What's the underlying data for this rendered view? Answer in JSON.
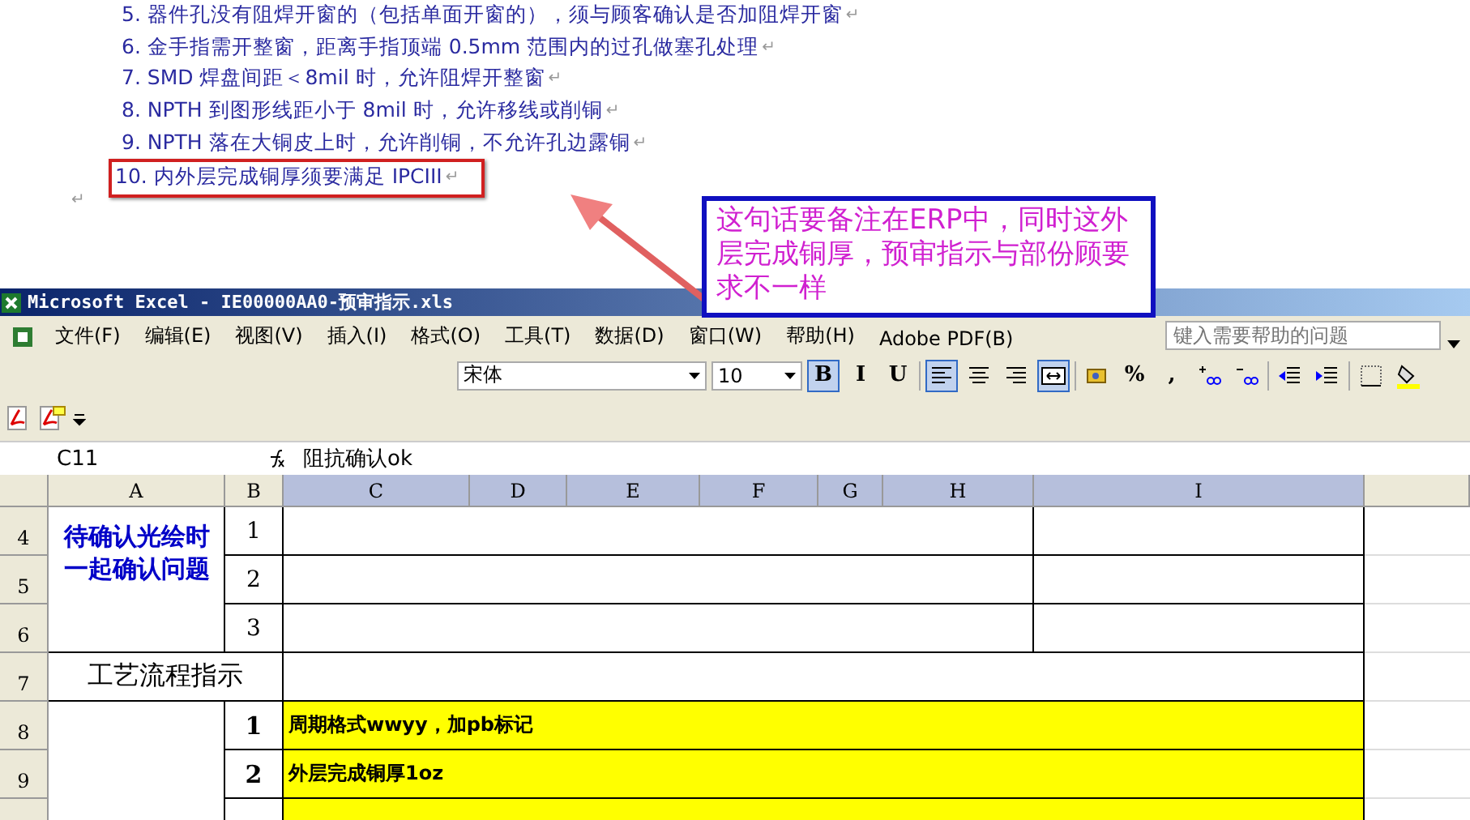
{
  "document": {
    "items": [
      {
        "number": "5.",
        "text": "器件孔没有阻焊开窗的（包括单面开窗的），须与顾客确认是否加阻焊开窗",
        "mark": "↵",
        "highlighted": false
      },
      {
        "number": "6.",
        "text": "金手指需开整窗，距离手指顶端 0.5mm 范围内的过孔做塞孔处理",
        "mark": "↵",
        "highlighted": false
      },
      {
        "number": "7.",
        "text": "SMD 焊盘间距＜8mil 时，允许阻焊开整窗",
        "mark": "↵",
        "highlighted": false
      },
      {
        "number": "8.",
        "text": "NPTH 到图形线距小于 8mil 时，允许移线或削铜",
        "mark": "↵",
        "highlighted": false
      },
      {
        "number": "9.",
        "text": "NPTH 落在大铜皮上时，允许削铜，不允许孔边露铜",
        "mark": "↵",
        "highlighted": false
      },
      {
        "number": "10.",
        "text": "内外层完成铜厚须要满足 IPCIII",
        "mark": "↵",
        "highlighted": true
      }
    ],
    "empty_paragraph_mark": "↵"
  },
  "annotation": {
    "text": "这句话要备注在ERP中，同时这外层完成铜厚，预审指示与部份顾要求不一样"
  },
  "excel": {
    "title": "Microsoft Excel - IE00000AA0-预审指示.xls",
    "menus": [
      "文件(F)",
      "编辑(E)",
      "视图(V)",
      "插入(I)",
      "格式(O)",
      "工具(T)",
      "数据(D)",
      "窗口(W)",
      "帮助(H)",
      "Adobe PDF(B)"
    ],
    "help_box": {
      "placeholder": "键入需要帮助的问题"
    },
    "font": "宋体",
    "font_size": "10",
    "format_buttons": [
      {
        "kind": "text",
        "label": "B",
        "selected": true
      },
      {
        "kind": "text",
        "label": "I",
        "selected": false
      },
      {
        "kind": "text",
        "label": "U",
        "selected": false
      },
      {
        "kind": "align-left",
        "selected": true
      },
      {
        "kind": "align-center",
        "selected": false
      },
      {
        "kind": "align-right",
        "selected": false
      },
      {
        "kind": "merge",
        "selected": true
      },
      {
        "kind": "currency",
        "selected": false
      },
      {
        "kind": "text",
        "label": "%",
        "selected": false
      },
      {
        "kind": "text",
        "label": ",",
        "selected": false
      },
      {
        "kind": "inc-decimal",
        "selected": false
      },
      {
        "kind": "dec-decimal",
        "selected": false
      },
      {
        "kind": "outdent",
        "selected": false
      },
      {
        "kind": "indent",
        "selected": false
      },
      {
        "kind": "borders",
        "selected": false
      },
      {
        "kind": "fill",
        "selected": false
      }
    ],
    "name_box": "C11",
    "formula": "阻抗确认ok",
    "columns": [
      {
        "label": "A",
        "selected": false
      },
      {
        "label": "B",
        "selected": false
      },
      {
        "label": "C",
        "selected": true
      },
      {
        "label": "D",
        "selected": true
      },
      {
        "label": "E",
        "selected": true
      },
      {
        "label": "F",
        "selected": true
      },
      {
        "label": "G",
        "selected": true
      },
      {
        "label": "H",
        "selected": true
      },
      {
        "label": "I",
        "selected": true
      }
    ],
    "rows": [
      {
        "kind": "question",
        "number": "4",
        "b": "1"
      },
      {
        "kind": "question",
        "number": "5",
        "b": "2"
      },
      {
        "kind": "question",
        "number": "6",
        "b": "3"
      },
      {
        "kind": "section",
        "number": "7",
        "a": "工艺流程指示"
      },
      {
        "kind": "step",
        "number": "8",
        "b": "1",
        "c": "周期格式wwyy，加pb标记"
      },
      {
        "kind": "step",
        "number": "9",
        "b": "2",
        "c": "外层完成铜厚1oz"
      },
      {
        "kind": "step-cut"
      }
    ],
    "question_label": "待确认光绘时一起确认问题"
  }
}
